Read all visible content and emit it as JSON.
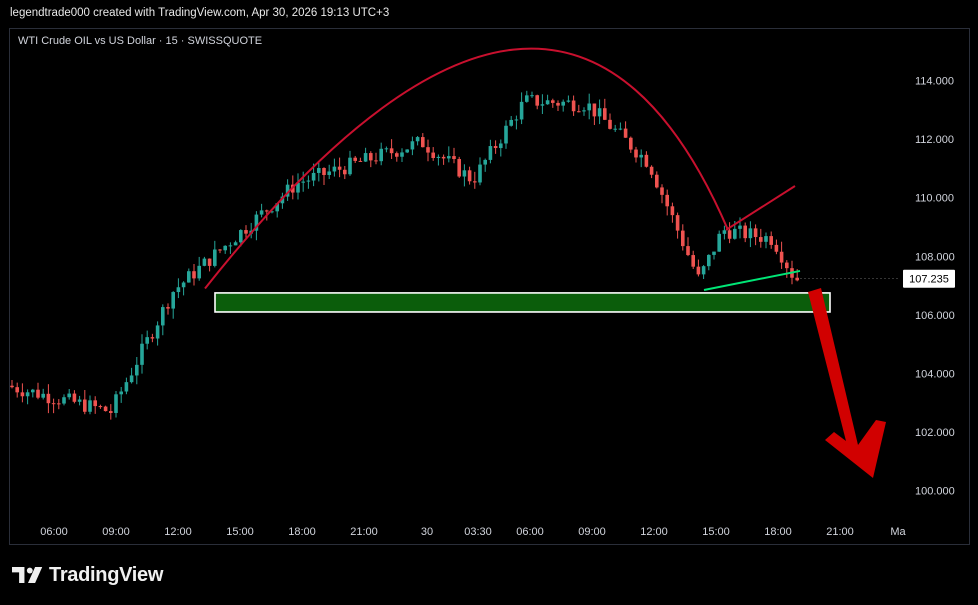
{
  "header": {
    "caption": "legendtrade000 created with TradingView.com, Apr 30, 2026 19:13 UTC+3"
  },
  "chart_data": {
    "type": "candlestick",
    "title": "WTI Crude OIL vs US Dollar · 15 · SWISSQUOTE",
    "price_axis": {
      "ticks": [
        114.0,
        112.0,
        110.0,
        108.0,
        106.0,
        104.0,
        102.0,
        100.0
      ],
      "tick_labels": [
        "114.000",
        "112.000",
        "110.000",
        "108.000",
        "106.000",
        "104.000",
        "102.000",
        "100.000"
      ],
      "last_price": 107.235,
      "last_price_label": "107.235"
    },
    "time_axis": {
      "ticks": [
        "06:00",
        "09:00",
        "12:00",
        "15:00",
        "18:00",
        "21:00",
        "30",
        "03:30",
        "06:00",
        "09:00",
        "12:00",
        "15:00",
        "18:00",
        "21:00",
        "Ma"
      ]
    },
    "colors": {
      "up": "#26a69a",
      "down": "#ef5350",
      "arc": "#c8102e",
      "trendline": "#00e676",
      "support_zone": "#0b5d0b",
      "arrow": "#d10000"
    },
    "key_points": [
      {
        "time": "start",
        "price": 103.6
      },
      {
        "time": "09:00",
        "price": 102.7
      },
      {
        "time": "12:00",
        "price": 106.8
      },
      {
        "time": "18:00",
        "price": 110.5
      },
      {
        "time": "21:00",
        "price": 111.2
      },
      {
        "time": "30",
        "price": 111.9
      },
      {
        "time": "03:30",
        "price": 110.6
      },
      {
        "time": "06:00",
        "price": 113.3
      },
      {
        "time": "09:00",
        "price": 113.2
      },
      {
        "time": "12:00",
        "price": 111.2
      },
      {
        "time": "15:00",
        "price": 107.2
      },
      {
        "time": "16:30",
        "price": 108.9
      },
      {
        "time": "18:00",
        "price": 108.6
      },
      {
        "time": "19:13",
        "price": 107.235
      }
    ],
    "annotations": {
      "rounded_top_peak_price": 114.8,
      "support_zone": {
        "from": 106.1,
        "to": 106.75
      },
      "wedge_upper": [
        108.9,
        110.4
      ],
      "wedge_lower": [
        106.85,
        107.5
      ]
    }
  },
  "footer": {
    "brand": "TradingView"
  }
}
